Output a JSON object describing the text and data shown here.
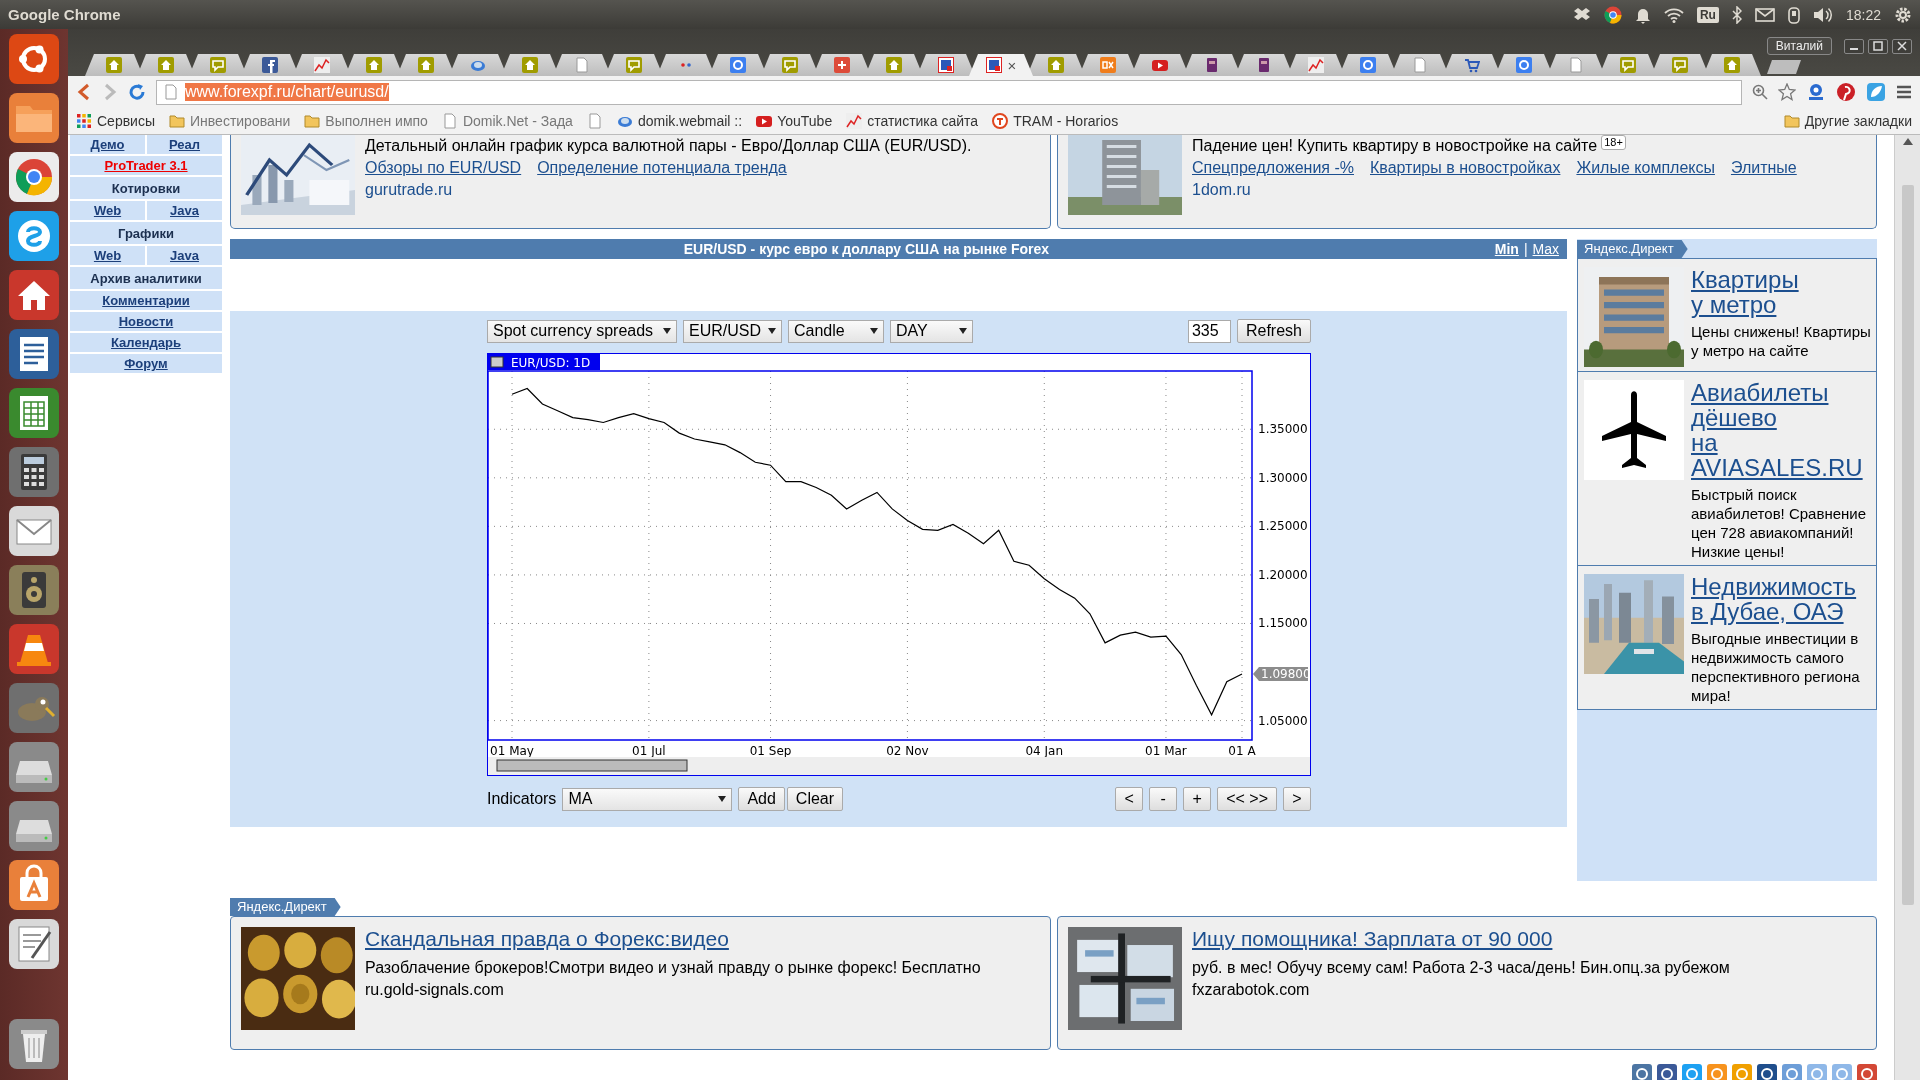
{
  "system_bar": {
    "app_title": "Google Chrome",
    "keyboard_layout": "Ru",
    "clock": "18:22"
  },
  "browser": {
    "tabs": [
      {
        "kind": "home",
        "selected": false
      },
      {
        "kind": "home",
        "selected": false
      },
      {
        "kind": "chat",
        "selected": false
      },
      {
        "kind": "facebook",
        "selected": false
      },
      {
        "kind": "chart",
        "selected": false
      },
      {
        "kind": "home",
        "selected": false
      },
      {
        "kind": "home",
        "selected": false
      },
      {
        "kind": "globe",
        "selected": false
      },
      {
        "kind": "home",
        "selected": false
      },
      {
        "kind": "page",
        "selected": false
      },
      {
        "kind": "chat",
        "selected": false
      },
      {
        "kind": "dots",
        "selected": false
      },
      {
        "kind": "google",
        "selected": false
      },
      {
        "kind": "chat",
        "selected": false
      },
      {
        "kind": "gplus",
        "selected": false
      },
      {
        "kind": "home",
        "selected": false
      },
      {
        "kind": "fx",
        "selected": false
      },
      {
        "kind": "fx",
        "selected": true
      },
      {
        "kind": "home",
        "selected": false
      },
      {
        "kind": "cx",
        "selected": false
      },
      {
        "kind": "youtube",
        "selected": false
      },
      {
        "kind": "book",
        "selected": false
      },
      {
        "kind": "book",
        "selected": false
      },
      {
        "kind": "chart",
        "selected": false
      },
      {
        "kind": "google",
        "selected": false
      },
      {
        "kind": "page",
        "selected": false
      },
      {
        "kind": "cart",
        "selected": false
      },
      {
        "kind": "google",
        "selected": false
      },
      {
        "kind": "page",
        "selected": false
      },
      {
        "kind": "chat",
        "selected": false
      },
      {
        "kind": "chat",
        "selected": false
      },
      {
        "kind": "home",
        "selected": false
      }
    ],
    "tab_close": "×",
    "profile": "Виталий",
    "url": "www.forexpf.ru/chart/eurusd/",
    "bookmarks": [
      {
        "kind": "apps",
        "label": "Сервисы"
      },
      {
        "kind": "folder",
        "label": "Инвестировани"
      },
      {
        "kind": "folder",
        "label": "Выполнен импо"
      },
      {
        "kind": "page",
        "label": "Domik.Net - Зада"
      },
      {
        "kind": "page"
      },
      {
        "kind": "globe",
        "label": "domik.webmail ::"
      },
      {
        "kind": "youtube",
        "label": "YouTube"
      },
      {
        "kind": "chart",
        "label": "статистика сайта"
      },
      {
        "kind": "tram",
        "label": "TRAM - Horarios"
      }
    ],
    "other_bookmarks": "Другие закладки"
  },
  "sidebar": {
    "items": [
      {
        "kind": "pair",
        "links": [
          "Демо",
          "Реал"
        ]
      },
      {
        "kind": "highlight",
        "label": "ProTrader 3.1"
      },
      {
        "kind": "heading",
        "label": "Котировки"
      },
      {
        "kind": "pair",
        "links": [
          "Web",
          "Java"
        ]
      },
      {
        "kind": "heading",
        "label": "Графики"
      },
      {
        "kind": "pair",
        "links": [
          "Web",
          "Java"
        ]
      },
      {
        "kind": "heading",
        "label": "Архив аналитики"
      },
      {
        "kind": "link",
        "label": "Комментарии"
      },
      {
        "kind": "link",
        "label": "Новости"
      },
      {
        "kind": "link",
        "label": "Календарь"
      },
      {
        "kind": "link",
        "label": "Форум"
      }
    ]
  },
  "top_ads": [
    {
      "text": "Детальный онлайн график курса валютной пары - Евро/Доллар США (EUR/USD).",
      "links": [
        "Обзоры по EUR/USD",
        "Определение потенциала тренда"
      ],
      "domain": "gurutrade.ru"
    },
    {
      "text": "Падение цен! Купить квартиру в новостройке на сайте",
      "badge": "18+",
      "links": [
        "Спецпредложения -%",
        "Квартиры в новостройках",
        "Жилые комплексы",
        "Элитные"
      ],
      "domain": "1dom.ru"
    }
  ],
  "chart_section": {
    "title": "EUR/USD - курс евро к доллару США на рынке Forex",
    "size_links": [
      "Min",
      "Max"
    ],
    "separator": "|",
    "selects": [
      "Spot currency spreads",
      "EUR/USD",
      "Candle",
      "DAY"
    ],
    "bars": "335",
    "refresh": "Refresh",
    "chart_data": {
      "type": "line",
      "title": "EUR/USD: 1D",
      "categories": [
        "01 May",
        null,
        null,
        null,
        null,
        null,
        null,
        null,
        null,
        "01 Jul",
        null,
        null,
        null,
        null,
        null,
        null,
        null,
        "01 Sep",
        null,
        null,
        null,
        null,
        null,
        null,
        null,
        null,
        "02 Nov",
        null,
        null,
        null,
        null,
        null,
        null,
        null,
        null,
        "04 Jan",
        null,
        null,
        null,
        null,
        null,
        null,
        null,
        "01 Mar",
        null,
        null,
        null,
        null,
        "01 A"
      ],
      "series": [
        {
          "color": "#000000",
          "values": [
            1.386,
            1.392,
            1.376,
            1.369,
            1.362,
            1.36,
            1.357,
            1.362,
            1.366,
            1.361,
            1.357,
            1.346,
            1.34,
            1.337,
            1.334,
            1.326,
            1.316,
            1.313,
            1.296,
            1.296,
            1.29,
            1.282,
            1.268,
            1.277,
            1.285,
            1.268,
            1.256,
            1.247,
            1.246,
            1.252,
            1.243,
            1.232,
            1.246,
            1.214,
            1.21,
            1.196,
            1.185,
            1.176,
            1.16,
            1.13,
            1.138,
            1.141,
            1.136,
            1.137,
            1.118,
            1.086,
            1.056,
            1.09,
            1.098
          ]
        }
      ],
      "ylim": [
        1.03,
        1.41
      ],
      "yticks": [
        {
          "value": 1.05,
          "label": "1.05000"
        },
        {
          "value": 1.15,
          "label": "1.15000"
        },
        {
          "value": 1.2,
          "label": "1.20000"
        },
        {
          "value": 1.25,
          "label": "1.25000"
        },
        {
          "value": 1.3,
          "label": "1.30000"
        },
        {
          "value": 1.35,
          "label": "1.35000"
        }
      ],
      "grid": true
    },
    "price_tag": "1.09800",
    "indicators_label": "Indicators",
    "indicator": "MA",
    "indicator_buttons": [
      "Add",
      "Clear"
    ],
    "nav_buttons": [
      "<",
      "-",
      "+",
      "<< >>",
      ">"
    ]
  },
  "side_ads": {
    "label": "Яндекс.Директ",
    "ads": [
      {
        "title": "Квартиры\nу метро",
        "text": "Цены снижены! Квартиры у метро на сайте"
      },
      {
        "title": "Авиабилеты\nдёшево\nна AVIASALES.RU",
        "text": "Быстрый поиск авиабилетов! Сравнение цен 728 авиакомпаний! Низкие цены!"
      },
      {
        "title": "Недвижимость\nв Дубае, ОАЭ",
        "text": "Выгодные инвестиции в недвижимость самого перспективного региона мира!"
      }
    ]
  },
  "bottom_ads": {
    "label": "Яндекс.Директ",
    "ads": [
      {
        "title": "Скандальная правда о Форекс:видео",
        "text": "Разоблачение брокеров!Смотри видео и узнай правду о рынке форекс! Бесплатно",
        "domain": "ru.gold-signals.com"
      },
      {
        "title": "Ищу помощника! Зарплата от 90 000",
        "text": "руб. в мес! Обучу всему сам! Работа 2-3 часа/день! Бин.опц.за рубежом",
        "domain": "fxzarabotok.com"
      }
    ]
  }
}
